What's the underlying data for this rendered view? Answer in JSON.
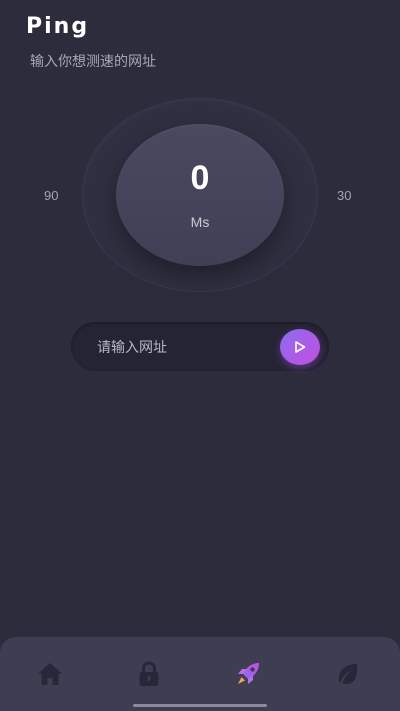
{
  "header": {
    "title": "Ping",
    "subtitle": "输入你想测速的网址"
  },
  "gauge": {
    "value": "0",
    "unit": "Ms",
    "scale_left": "90",
    "scale_right": "30"
  },
  "url_input": {
    "placeholder": "请输入网址",
    "value": ""
  },
  "nav": {
    "items": [
      {
        "icon": "home-icon"
      },
      {
        "icon": "lock-icon"
      },
      {
        "icon": "rocket-icon",
        "active": true
      },
      {
        "icon": "leaf-icon"
      }
    ]
  },
  "colors": {
    "background": "#2d2c3d",
    "accent_start": "#8d6cf0",
    "accent_end": "#c24fe0",
    "nav_background": "#3e3d51"
  }
}
